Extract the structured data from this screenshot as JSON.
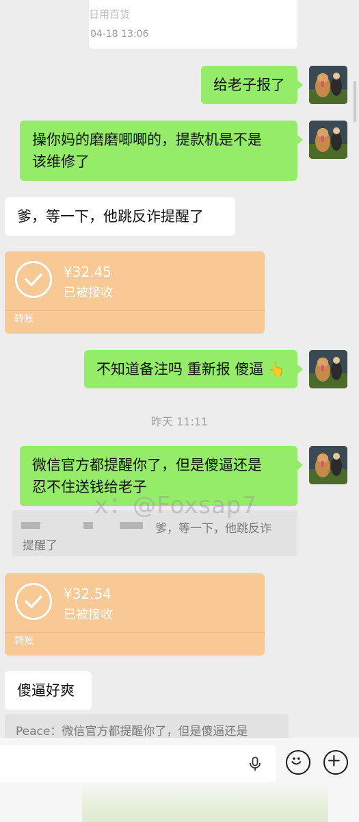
{
  "header_card": {
    "line1": "日用百货",
    "line2": "04-18 13:06"
  },
  "messages": [
    {
      "side": "me",
      "text": "给老子报了"
    },
    {
      "side": "me",
      "line1": "操你妈的磨磨唧唧的，提款机是不是",
      "line2": "该维修了"
    },
    {
      "side": "other",
      "text": "爹，等一下，他跳反诈提醒了"
    },
    {
      "type": "transfer",
      "amount": "¥32.45",
      "status": "已被接收",
      "kind": "转账"
    },
    {
      "side": "me",
      "text": "不知道备注吗 重新报 傻逼",
      "emoji": "👆"
    },
    {
      "type": "time",
      "text": "昨天 11:11"
    },
    {
      "side": "me",
      "line1": "微信官方都提醒你了，但是傻逼还是",
      "line2": "忍不住送钱给老子"
    },
    {
      "type": "quote",
      "line1": "爹，等一下，他跳反诈",
      "line2": "提醒了"
    },
    {
      "type": "transfer",
      "amount": "¥32.54",
      "status": "已被接收",
      "kind": "转账"
    },
    {
      "side": "other",
      "text": "傻逼好爽"
    },
    {
      "type": "quote",
      "text": "Peace：微信官方都提醒你了，但是傻逼还是"
    }
  ],
  "watermark": "x：@Foxsap7",
  "input_bar": {
    "voice_icon": "microphone-icon",
    "emoji_icon": "smiley-icon",
    "plus_icon": "plus-icon"
  },
  "colors": {
    "background": "#ededed",
    "my_bubble": "#95ec69",
    "other_bubble": "#ffffff",
    "transfer": "#f8c895"
  }
}
